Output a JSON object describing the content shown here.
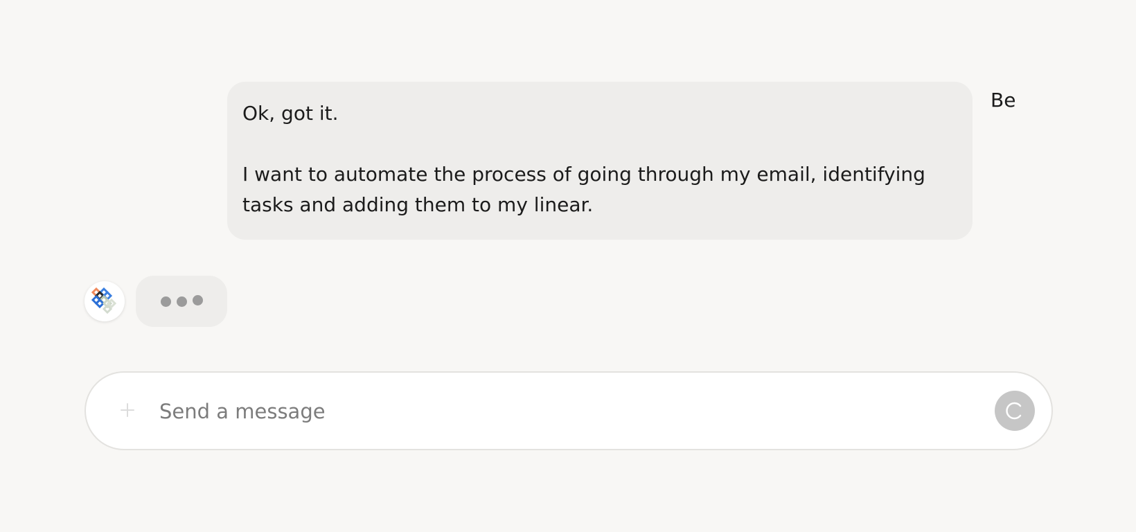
{
  "conversation": {
    "user_message": {
      "paragraphs": [
        "Ok, got it.",
        "I want to automate the process of going through my email, identifying tasks and adding them to my linear."
      ],
      "sender": "Be"
    },
    "assistant_message": {
      "avatar_icon": "assistant-logo-icon",
      "status": "typing-indicator"
    }
  },
  "composer": {
    "placeholder": "Send a message",
    "value": "",
    "attach_icon": "plus-icon",
    "send_icon": "loading-spinner-icon"
  },
  "colors": {
    "background": "#f8f7f5",
    "bubble": "#eeedeb",
    "send_button": "#c6c6c6",
    "dot": "#9b9b9b"
  }
}
